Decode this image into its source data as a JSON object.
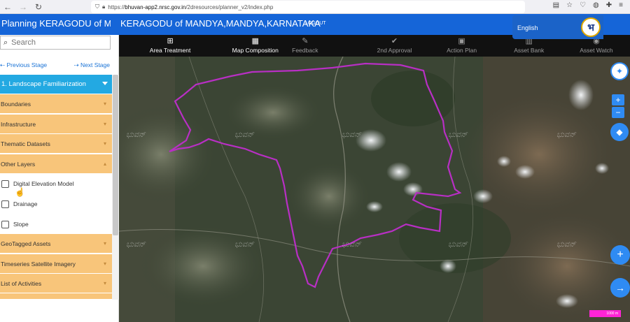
{
  "browser": {
    "url_prefix": "https://",
    "url_host": "bhuvan-app2.nrsc.gov.in",
    "url_path": "/2dresources/planner_v2/index.php"
  },
  "header": {
    "title_left": "Planning KERAGODU of M...",
    "title_main": "KERAGODU of MANDYA,MANDYA,KARNATAKA",
    "logout": "LOGOUT",
    "language": "English",
    "logo_glyph": "भ"
  },
  "toolbar": [
    {
      "label": "Area Treatment",
      "icon": "plus-square-icon",
      "glyph": "⊞",
      "active": true
    },
    {
      "label": "Map Composition",
      "icon": "map-icon",
      "glyph": "▦",
      "active": true
    },
    {
      "label": "Feedback",
      "icon": "comment-icon",
      "glyph": "✎",
      "active": false
    },
    {
      "label": "2nd Approval",
      "icon": "check-circle-icon",
      "glyph": "✔",
      "active": false
    },
    {
      "label": "Action Plan",
      "icon": "save-icon",
      "glyph": "▣",
      "active": false
    },
    {
      "label": "Asset Bank",
      "icon": "bank-icon",
      "glyph": "▥",
      "active": false
    },
    {
      "label": "Asset Watch",
      "icon": "eye-icon",
      "glyph": "◉",
      "active": false
    }
  ],
  "sidebar": {
    "search_placeholder": "Search",
    "prev_stage": "Previous Stage",
    "next_stage": "Next Stage",
    "stage_title": "1. Landscape Familiarization",
    "sections_top": [
      "Boundaries",
      "Infrastructure",
      "Thematic Datasets",
      "Other Layers"
    ],
    "layers": [
      "Digital Elevation Model",
      "Drainage",
      "Slope"
    ],
    "sections_bottom": [
      "GeoTagged Assets",
      "Timeseries Satellite Imagery",
      "List of Activities"
    ]
  },
  "map": {
    "watermark": "ಭುವನ್",
    "scale_label": "1000 m",
    "boundary_color": "#b82fc4"
  }
}
